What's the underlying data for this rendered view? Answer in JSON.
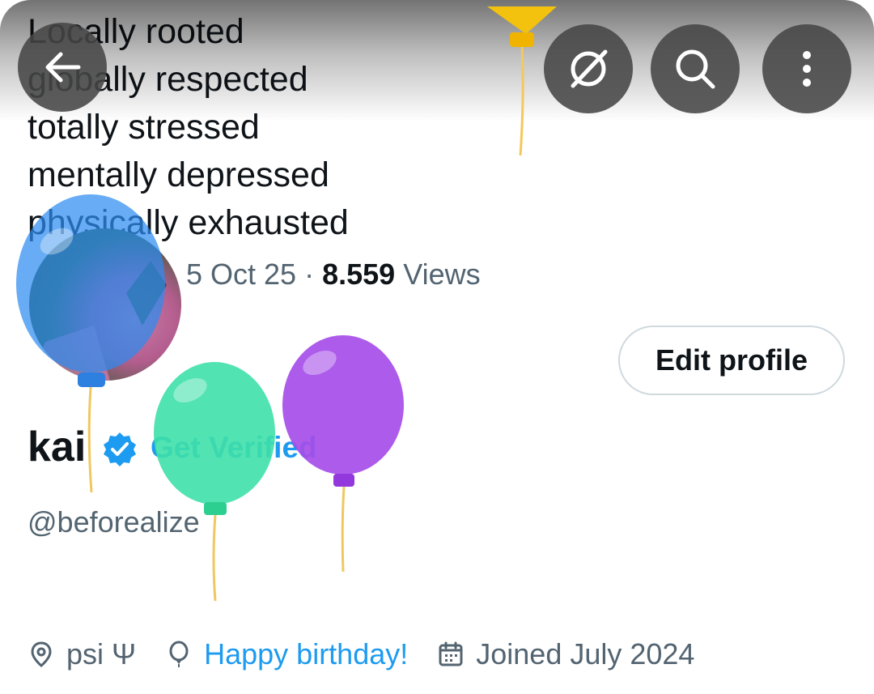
{
  "banner": {
    "lines": [
      "Locally rooted",
      "globally respected",
      "totally stressed",
      "mentally depressed",
      "physically exhausted"
    ]
  },
  "top_bar": {
    "back_icon": "arrow-left-icon",
    "grok_icon": "grok-icon",
    "search_icon": "search-icon",
    "more_icon": "more-vertical-icon"
  },
  "post_meta": {
    "date": "5 Oct 25",
    "separator": "·",
    "views_count": "8.559",
    "views_label": "Views"
  },
  "profile": {
    "edit_button": "Edit profile",
    "name": "kai",
    "get_verified": "Get Verified",
    "handle": "@beforealize",
    "location": "psi Ψ",
    "birthday": "Happy birthday!",
    "joined": "Joined July 2024"
  },
  "colors": {
    "accent": "#1d9bf0",
    "secondary_text": "#536471",
    "primary_text": "#0f1419",
    "balloon_yellow": "#f2c20f",
    "balloon_blue": "#2d8cf0",
    "balloon_green": "#3ee0a8",
    "balloon_purple": "#a64de8"
  }
}
